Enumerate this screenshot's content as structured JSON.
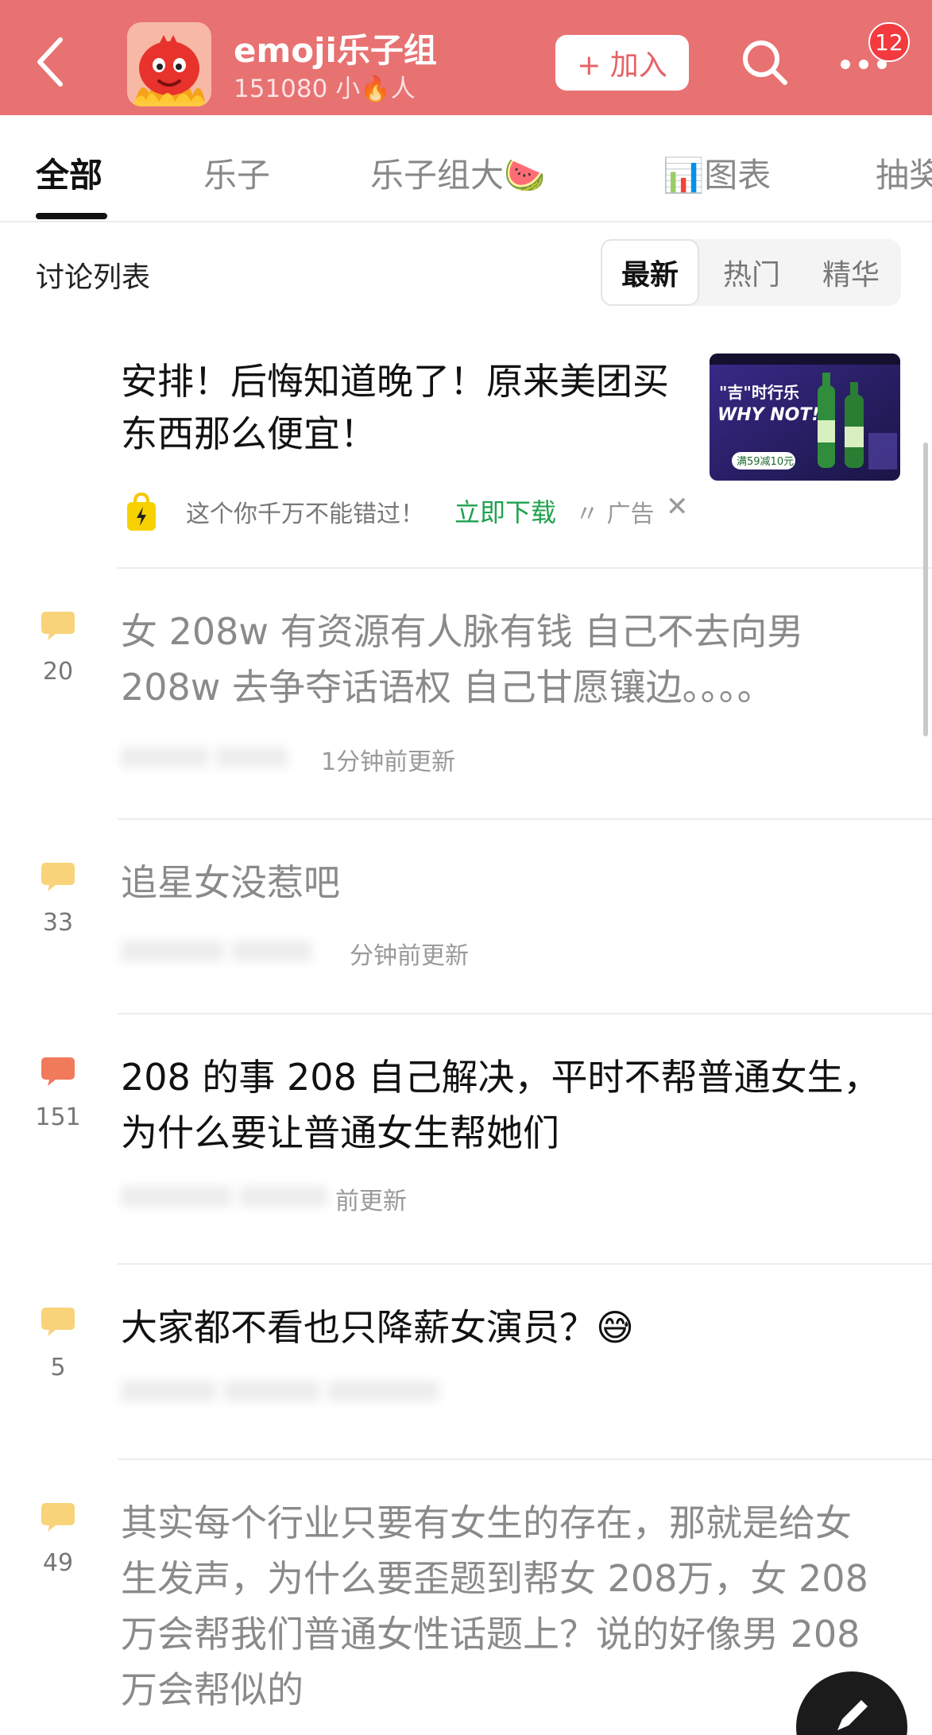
{
  "header": {
    "group_name": "emoji乐子组",
    "member_count": "151080 小🔥人",
    "join_label": "+ 加入",
    "badge_count": "12",
    "bg_color": "#e87172"
  },
  "tabs": [
    {
      "label": "全部",
      "active": true
    },
    {
      "label": "乐子",
      "active": false
    },
    {
      "label": "乐子组大🍉",
      "active": false
    },
    {
      "label": "📊图表",
      "active": false
    },
    {
      "label": "抽奖",
      "active": false
    }
  ],
  "list_header": {
    "title": "讨论列表",
    "sort_options": [
      "最新",
      "热门",
      "精华"
    ],
    "selected": "最新"
  },
  "ad": {
    "title": "安排！后悔知道晚了！原来美团买东西那么便宜！",
    "desc": "这个你千万不能错过！",
    "download": "立即下载",
    "label": "广告",
    "close": "✕",
    "image_text_1": "\"吉\"时行乐",
    "image_text_2": "WHY NOT!",
    "image_text_3": "满59减10元"
  },
  "posts": [
    {
      "comments": "20",
      "title": "女 208w 有资源有人脉有钱 自己不去向男 208w 去争夺话语权 自己甘愿镶边。。。。",
      "time": "1分钟前更新",
      "read": true
    },
    {
      "comments": "33",
      "title": "追星女没惹吧",
      "time": "分钟前更新",
      "read": true
    },
    {
      "comments": "151",
      "title": "208 的事 208 自己解决，平时不帮普通女生，为什么要让普通女生帮她们",
      "time": "前更新",
      "read": false
    },
    {
      "comments": "5",
      "title": "大家都不看也只降薪女演员？😅",
      "time": "",
      "read": false
    },
    {
      "comments": "49",
      "title": "其实每个行业只要有女生的存在，那就是给女生发声，为什么要歪题到帮女 208万，女 208万会帮我们普通女性话题上？说的好像男 208万会帮似的",
      "time": "",
      "read": true
    }
  ],
  "colors": {
    "accent": "#e87172",
    "comment_icon": "#f8d37a",
    "comment_icon_hot": "#f07a5a",
    "download_green": "#1ea24d"
  }
}
